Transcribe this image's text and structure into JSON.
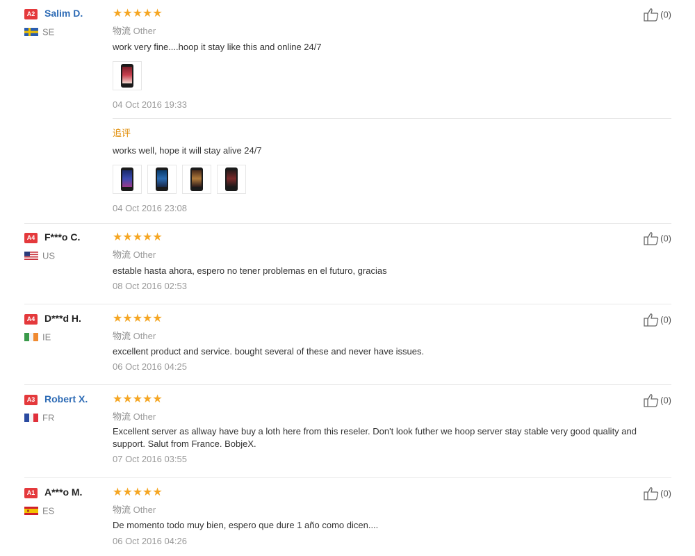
{
  "reviews": [
    {
      "level": "A2",
      "name": "Salim D.",
      "country": "SE",
      "flag": "se",
      "rating": 5,
      "logistics_label": "物流",
      "logistics_value": "Other",
      "text": "work very fine....hoop it stay like this and online 24/7",
      "date": "04 Oct 2016 19:33",
      "photos": 1,
      "followup": {
        "label": "追评",
        "text": "works well, hope it will stay alive 24/7",
        "date": "04 Oct 2016 23:08",
        "photos": 4
      },
      "likes": "(0)"
    },
    {
      "level": "A4",
      "name": "F***o C.",
      "country": "US",
      "flag": "us",
      "rating": 5,
      "logistics_label": "物流",
      "logistics_value": "Other",
      "text": "estable hasta ahora, espero no tener problemas en el futuro, gracias",
      "date": "08 Oct 2016 02:53",
      "likes": "(0)"
    },
    {
      "level": "A4",
      "name": "D***d H.",
      "country": "IE",
      "flag": "ie",
      "rating": 5,
      "logistics_label": "物流",
      "logistics_value": "Other",
      "text": "excellent product and service. bought several of these and never have issues.",
      "date": "06 Oct 2016 04:25",
      "likes": "(0)"
    },
    {
      "level": "A3",
      "name": "Robert X.",
      "country": "FR",
      "flag": "fr",
      "rating": 5,
      "logistics_label": "物流",
      "logistics_value": "Other",
      "text": "Excellent server as allway have buy a loth here from this reseler. Don't look futher we hoop server stay stable very good quality and support. Salut from France. BobjeX.",
      "date": "07 Oct 2016 03:55",
      "likes": "(0)"
    },
    {
      "level": "A1",
      "name": "A***o M.",
      "country": "ES",
      "flag": "es",
      "rating": 5,
      "logistics_label": "物流",
      "logistics_value": "Other",
      "text": "De momento todo muy bien, espero que dure 1 año como dicen....",
      "date": "06 Oct 2016 04:26",
      "likes": "(0)"
    }
  ],
  "colors": {
    "star": "#f5a623",
    "level_badge": "#e4393c",
    "name_link": "#2d6bb5",
    "followup_label": "#e08a00"
  }
}
